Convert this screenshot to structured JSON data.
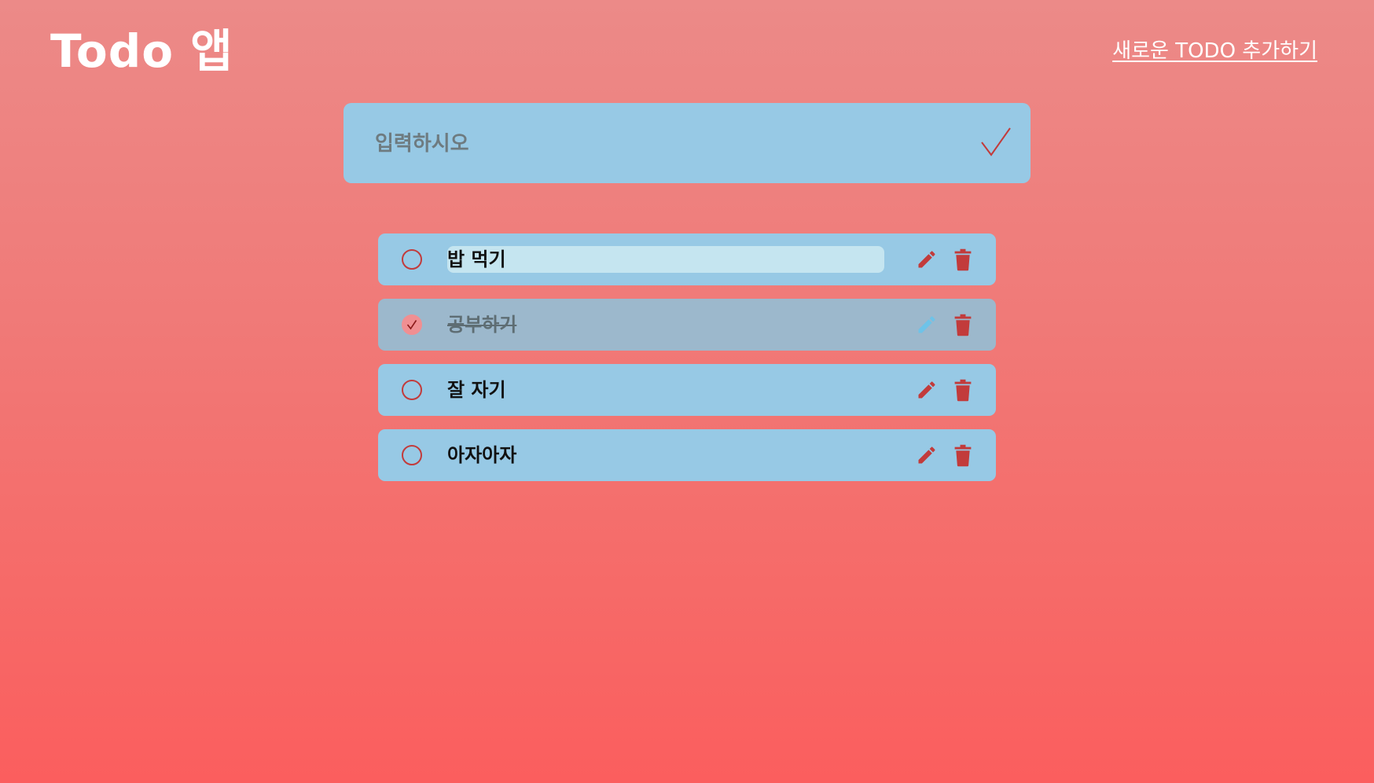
{
  "header": {
    "title": "Todo 앱",
    "add_link_label": "새로운 TODO 추가하기"
  },
  "input": {
    "placeholder": "입력하시오",
    "value": "",
    "submit_icon": "checkmark-icon"
  },
  "todos": [
    {
      "text": "밥 먹기",
      "done": false,
      "editing": true
    },
    {
      "text": "공부하기",
      "done": true,
      "editing": false
    },
    {
      "text": "잘 자기",
      "done": false,
      "editing": false
    },
    {
      "text": "아자아자",
      "done": false,
      "editing": false
    }
  ],
  "icons": {
    "edit": "pencil-icon",
    "delete": "trash-icon",
    "toggle": "circle-checkbox-icon"
  },
  "colors": {
    "accent": "#c23b3b",
    "item_background": "#97c9e5",
    "item_done_background": "#9cb8cc",
    "done_edit_icon": "#6ec3e8",
    "background_top": "#ec8a88",
    "background_bottom": "#fb5e5e"
  }
}
